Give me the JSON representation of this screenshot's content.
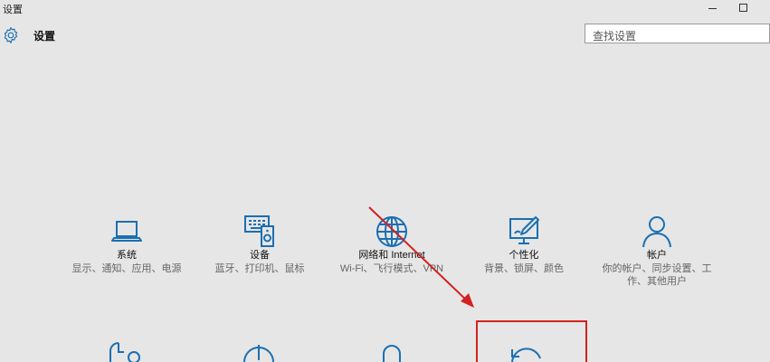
{
  "window": {
    "title": "设置",
    "minimize_icon": "minimize-icon",
    "maximize_icon": "maximize-icon"
  },
  "header": {
    "title": "设置",
    "icon": "gear-icon"
  },
  "search": {
    "placeholder": "查找设置"
  },
  "tiles": [
    {
      "name": "系统",
      "desc": "显示、通知、应用、电源",
      "icon": "laptop-icon"
    },
    {
      "name": "设备",
      "desc": "蓝牙、打印机、鼠标",
      "icon": "devices-icon"
    },
    {
      "name": "网络和 Internet",
      "desc": "Wi-Fi、飞行模式、VPN",
      "icon": "globe-icon"
    },
    {
      "name": "个性化",
      "desc": "背景、锁屏、颜色",
      "icon": "personalization-icon"
    },
    {
      "name": "帐户",
      "desc": "你的帐户、同步设置、工作、其他用户",
      "icon": "person-icon"
    }
  ],
  "lower_row_icons": [
    "time-language-icon",
    "ease-of-access-icon",
    "privacy-lock-icon",
    "update-security-icon"
  ],
  "annotations": {
    "color": "#d42020",
    "arrow": "red arrow pointing to the update & security tile",
    "highlight": "red rectangle around the update & security tile"
  }
}
